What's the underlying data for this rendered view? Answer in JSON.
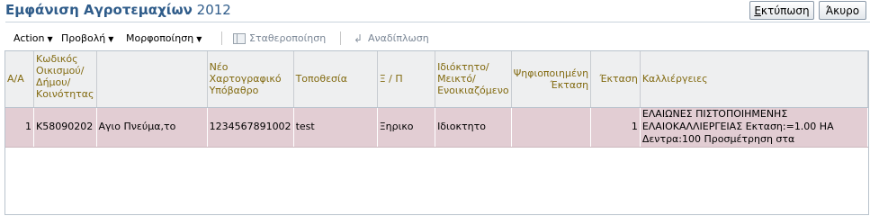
{
  "header": {
    "title_bold": "Εμφάνιση Αγροτεμαχίων",
    "title_year": "2012",
    "print_label": "Εκτύπωση",
    "cancel_label": "Άκυρο"
  },
  "toolbar": {
    "actions": "Action",
    "view": "Προβολή",
    "format": "Μορφοποίηση",
    "freeze": "Σταθεροποίηση",
    "wrap": "Αναδίπλωση"
  },
  "table": {
    "columns": [
      "Α/Α",
      "Κωδικός Οικισμού/ Δήμου/ Κοινότητας",
      "",
      "Νέο Χαρτογραφικό Υπόβαθρο",
      "Τοποθεσία",
      "Ξ / Π",
      "Ιδιόκτητο/ Μεικτό/ Ενοικιαζόμενο",
      "Ψηφιοποιημένη Έκταση",
      "Έκταση",
      "Καλλιέργειες"
    ],
    "rows": [
      {
        "aa": "1",
        "code": "K58090202",
        "name": "Αγιο Πνεύμα,το",
        "map": "1234567891002",
        "location": "test",
        "xp": "Ξηρικο",
        "ownership": "Ιδιοκτητο",
        "digitized": "",
        "area": "1",
        "crops_line1": "ΕΛΑΙΩΝΕΣ ΠΙΣΤΟΠΟΙΗΜΕΝΗΣ",
        "crops_line2": "ΕΛΑΙΟΚΑΛΛΙΕΡΓΕΙΑΣ Εκταση:=1.00 HA",
        "crops_line3": "Δεντρα:100 Προσμέτρηση στα"
      }
    ]
  }
}
